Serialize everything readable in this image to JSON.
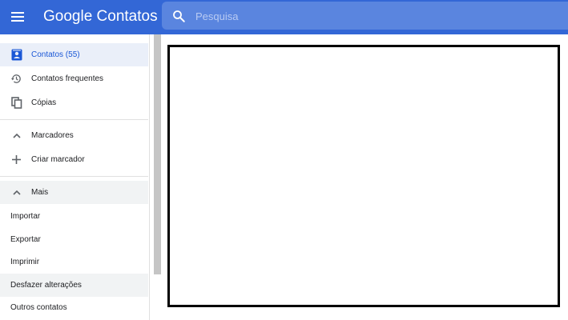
{
  "header": {
    "app_title": "Google Contatos",
    "search_placeholder": "Pesquisa"
  },
  "sidebar": {
    "contacts": "Contatos (55)",
    "frequent": "Contatos frequentes",
    "copies": "Cópias",
    "labels": "Marcadores",
    "create_label": "Criar marcador",
    "more": "Mais",
    "import": "Importar",
    "export": "Exportar",
    "print": "Imprimir",
    "undo_changes": "Desfazer alterações",
    "other_contacts": "Outros contatos"
  },
  "colors": {
    "header_bg": "#3367d6",
    "accent": "#1a57d6"
  },
  "icons": {
    "menu": "hamburger-menu-icon",
    "search": "search-icon",
    "contacts": "contact-card-icon",
    "frequent": "history-icon",
    "copies": "copy-icon",
    "labels_toggle": "chevron-up-icon",
    "create_label": "plus-icon",
    "more_toggle": "chevron-up-icon"
  }
}
